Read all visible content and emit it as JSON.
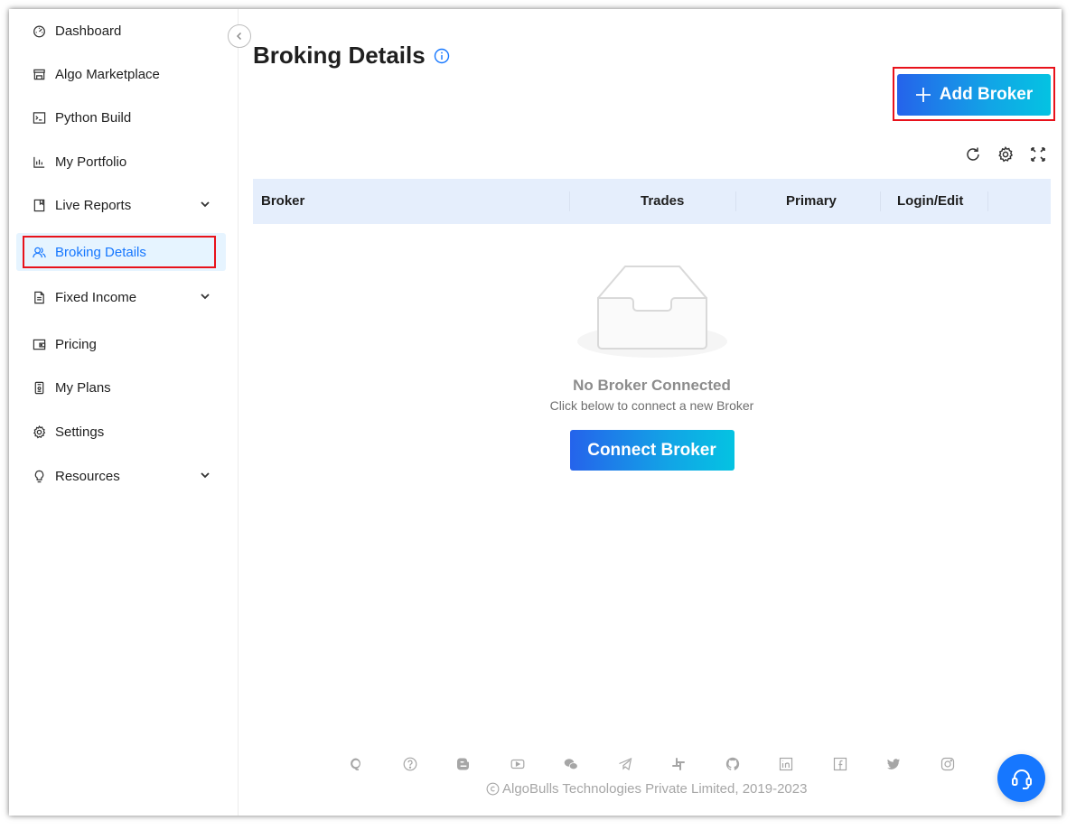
{
  "sidebar": {
    "items": [
      {
        "label": "Dashboard",
        "icon": "dashboard-icon"
      },
      {
        "label": "Algo Marketplace",
        "icon": "shop-icon"
      },
      {
        "label": "Python Build",
        "icon": "code-icon"
      },
      {
        "label": "My Portfolio",
        "icon": "bar-chart-icon"
      },
      {
        "label": "Live Reports",
        "icon": "book-icon",
        "expandable": true
      },
      {
        "label": "Broking Details",
        "icon": "user-group-icon",
        "active": true
      },
      {
        "label": "Fixed Income",
        "icon": "file-icon",
        "expandable": true
      },
      {
        "label": "Pricing",
        "icon": "wallet-icon"
      },
      {
        "label": "My Plans",
        "icon": "plan-icon"
      },
      {
        "label": "Settings",
        "icon": "gear-icon"
      },
      {
        "label": "Resources",
        "icon": "bulb-icon",
        "expandable": true
      }
    ]
  },
  "main": {
    "title": "Broking Details",
    "add_broker_label": "Add Broker",
    "table": {
      "columns": [
        "Broker",
        "Trades",
        "Primary",
        "Login/Edit"
      ]
    },
    "empty": {
      "title": "No Broker Connected",
      "subtitle": "Click below to connect a new Broker",
      "button_label": "Connect Broker"
    }
  },
  "footer": {
    "social_icons": [
      "quora-icon",
      "help-icon",
      "blogger-icon",
      "youtube-icon",
      "wechat-icon",
      "telegram-icon",
      "slack-icon",
      "github-icon",
      "linkedin-icon",
      "facebook-icon",
      "twitter-icon",
      "instagram-icon"
    ],
    "copyright": "AlgoBulls Technologies Private Limited, 2019-2023"
  },
  "colors": {
    "accent": "#1677ff",
    "highlight": "#e8121b",
    "table_header_bg": "#e5eefc",
    "active_item_bg": "#e6f4ff"
  }
}
